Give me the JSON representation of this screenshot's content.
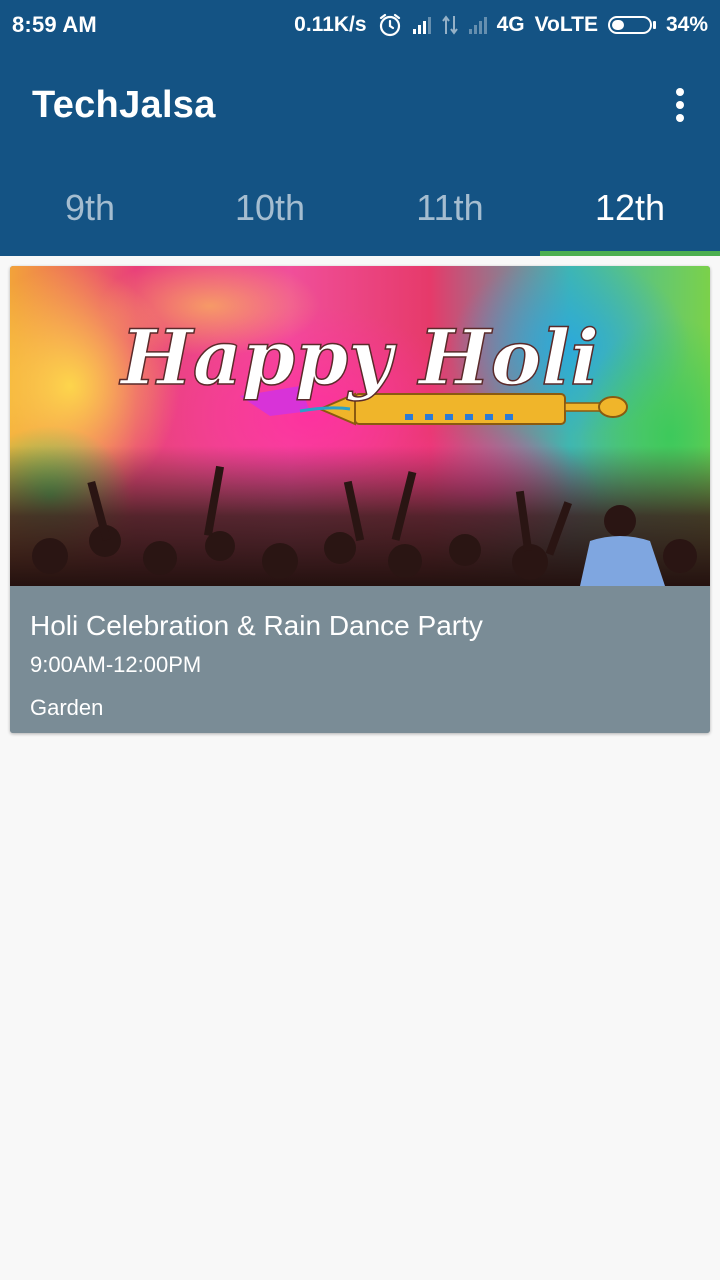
{
  "status_bar": {
    "time": "8:59 AM",
    "network_speed": "0.11K/s",
    "network_type": "4G",
    "volte": "VoLTE",
    "battery_percent": "34%",
    "battery_level": 0.34,
    "icons": [
      "alarm-icon",
      "signal-icon",
      "data-transfer-icon",
      "signal-icon",
      "battery-icon"
    ]
  },
  "app_bar": {
    "title": "TechJalsa",
    "menu_icon": "overflow-menu-icon"
  },
  "tabs": {
    "items": [
      {
        "label": "9th",
        "active": false
      },
      {
        "label": "10th",
        "active": false
      },
      {
        "label": "11th",
        "active": false
      },
      {
        "label": "12th",
        "active": true
      }
    ],
    "indicator_color": "#4caf50"
  },
  "events": [
    {
      "image_text": "Happy Holi",
      "title": "Holi Celebration & Rain Dance Party",
      "time": "9:00AM-12:00PM",
      "location": "Garden"
    }
  ],
  "colors": {
    "primary": "#145384",
    "card_info_bg": "#7a8c96",
    "background": "#f8f8f8"
  }
}
